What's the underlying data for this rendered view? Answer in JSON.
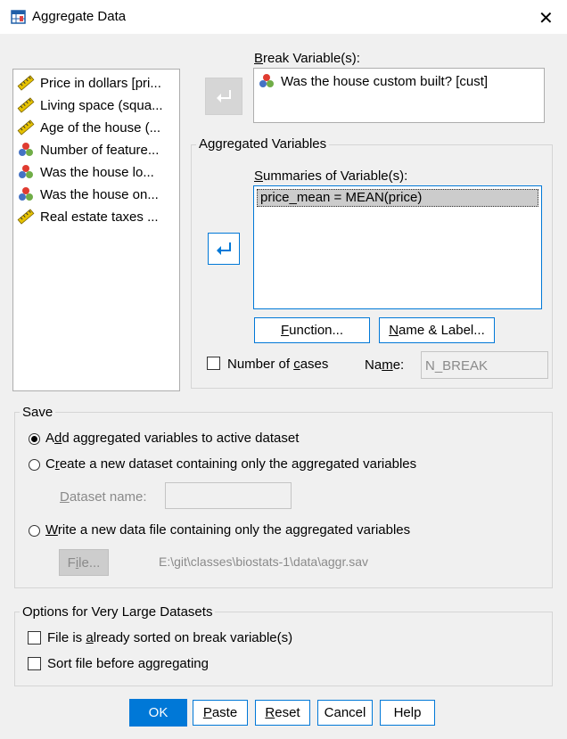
{
  "window": {
    "title": "Aggregate Data",
    "close_icon": "✕"
  },
  "source_vars": [
    {
      "label": "Price in dollars [pri...",
      "icon": "ruler-icon"
    },
    {
      "label": "Living space (squa...",
      "icon": "ruler-icon"
    },
    {
      "label": "Age of the house (...",
      "icon": "ruler-icon"
    },
    {
      "label": "Number of feature...",
      "icon": "nominal-icon"
    },
    {
      "label": "Was the house lo...",
      "icon": "nominal-icon"
    },
    {
      "label": "Was the house on...",
      "icon": "nominal-icon"
    },
    {
      "label": "Real estate taxes ...",
      "icon": "ruler-icon"
    }
  ],
  "break": {
    "label_pre": "",
    "label_u": "B",
    "label_post": "reak Variable(s):",
    "item": "Was the house custom built? [cust]"
  },
  "aggregated": {
    "group_title": "Aggregated Variables",
    "summaries_u": "S",
    "summaries_post": "ummaries of Variable(s):",
    "item": "price_mean = MEAN(price)",
    "function_u": "F",
    "function_post": "unction...",
    "namelabel_u": "N",
    "namelabel_post": "ame & Label...",
    "cases_pre": "Number of ",
    "cases_u": "c",
    "cases_post": "ases",
    "name_pre": "Na",
    "name_u": "m",
    "name_post": "e:",
    "name_value": "N_BREAK"
  },
  "save": {
    "group_title": "Save",
    "opt1_pre": "A",
    "opt1_u": "d",
    "opt1_post": "d aggregated variables to active dataset",
    "opt2_pre": "C",
    "opt2_u": "r",
    "opt2_post": "eate a new dataset containing only the aggregated variables",
    "dataset_name_u": "D",
    "dataset_name_post": "ataset name:",
    "opt3_u": "W",
    "opt3_post": "rite a new data file containing only the aggregated variables",
    "file_pre": "F",
    "file_u": "i",
    "file_post": "le...",
    "file_path": "E:\\git\\classes\\biostats-1\\data\\aggr.sav"
  },
  "options": {
    "group_title": "Options for Very Large Datasets",
    "sorted_pre": "File is ",
    "sorted_u": "a",
    "sorted_post": "lready sorted on break variable(s)",
    "sort_pre": "Sort file before a",
    "sort_u": "g",
    "sort_post": "gregating"
  },
  "buttons": {
    "ok": "OK",
    "paste_u": "P",
    "paste_post": "aste",
    "reset_u": "R",
    "reset_post": "eset",
    "cancel": "Cancel",
    "help": "Help"
  },
  "colors": {
    "accent": "#0078d7",
    "selection": "#cccccc"
  }
}
